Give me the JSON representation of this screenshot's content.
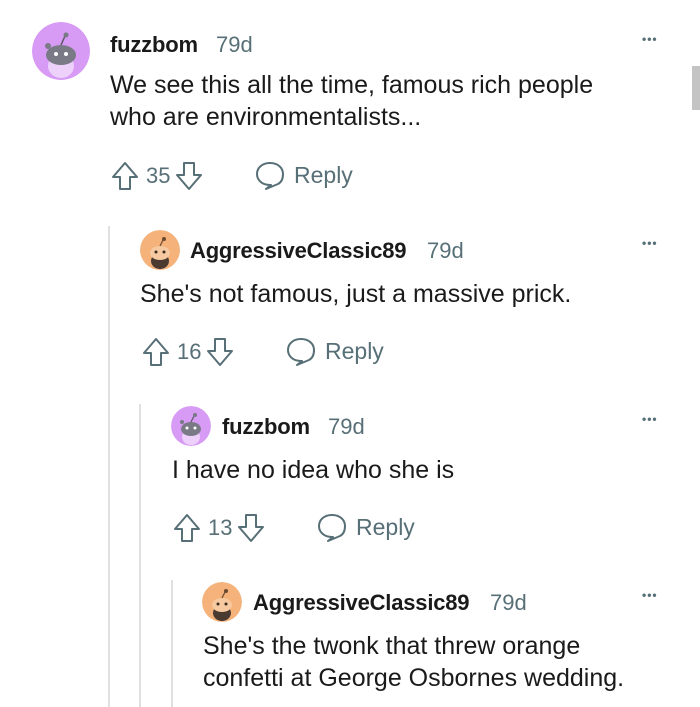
{
  "comments": [
    {
      "username": "fuzzbom",
      "age": "79d",
      "body": [
        "We see this all the time, famous rich people",
        "who are environmentalists..."
      ],
      "score": "35",
      "reply_label": "Reply",
      "avatar_color": "#d79af5"
    },
    {
      "username": "AggressiveClassic89",
      "age": "79d",
      "body": [
        "She's not famous, just a massive prick."
      ],
      "score": "16",
      "reply_label": "Reply",
      "avatar_color": "#f5b27a"
    },
    {
      "username": "fuzzbom",
      "age": "79d",
      "body": [
        "I have no idea who she is"
      ],
      "score": "13",
      "reply_label": "Reply",
      "avatar_color": "#d79af5"
    },
    {
      "username": "AggressiveClassic89",
      "age": "79d",
      "body": [
        "She's the twonk that threw orange",
        "confetti at George Osbornes wedding."
      ],
      "reply_label": "Reply",
      "avatar_color": "#f5b27a"
    }
  ],
  "more_label": "•••",
  "colors": {
    "meta": "#576f76",
    "line": "#e0e0e0"
  }
}
